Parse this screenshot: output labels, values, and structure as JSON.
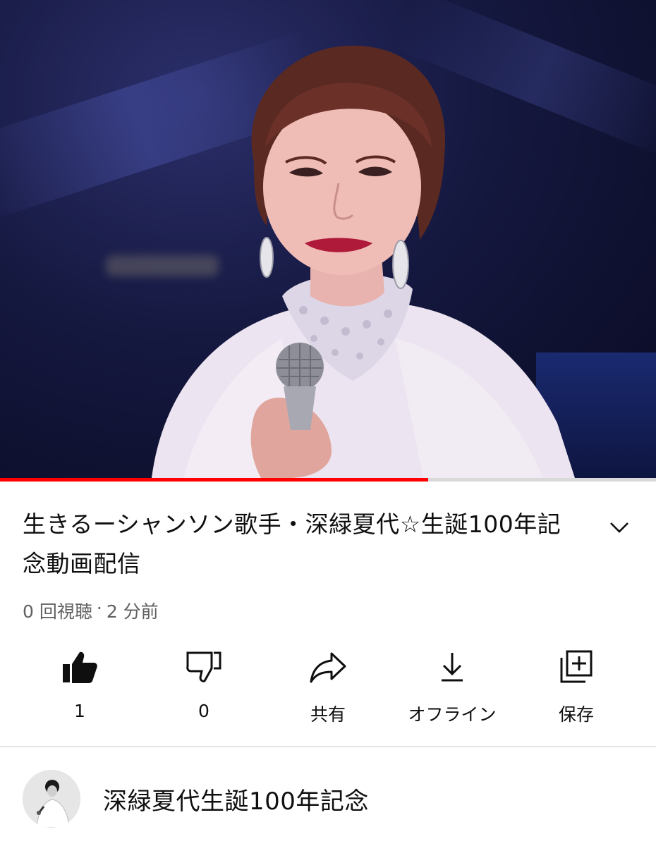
{
  "video": {
    "progress_percent": 65.3,
    "colors": {
      "progress": "#ff0000",
      "track": "#d9d9d9"
    }
  },
  "title": "生きるーシャンソン歌手・深緑夏代☆生誕100年記念動画配信",
  "meta": {
    "views": "0 回視聴",
    "separator": "·",
    "time_ago": "2 分前"
  },
  "expand_icon": "chevron-down-icon",
  "actions": [
    {
      "icon": "thumbs-up-icon",
      "label": "1"
    },
    {
      "icon": "thumbs-down-icon",
      "label": "0"
    },
    {
      "icon": "share-icon",
      "label": "共有"
    },
    {
      "icon": "download-icon",
      "label": "オフライン"
    },
    {
      "icon": "save-playlist-icon",
      "label": "保存"
    }
  ],
  "channel": {
    "name": "深緑夏代生誕100年記念"
  }
}
